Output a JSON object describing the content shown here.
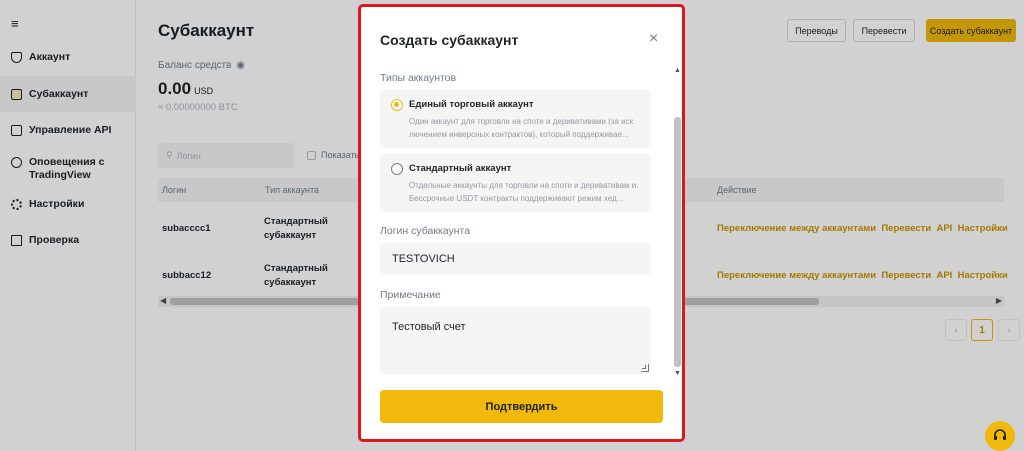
{
  "sidebar": {
    "menu_icon": "menu-icon",
    "items": [
      {
        "label": "Аккаунт",
        "icon": "shield-icon"
      },
      {
        "label": "Субаккаунт",
        "icon": "subaccount-icon"
      },
      {
        "label": "Управление API",
        "icon": "api-icon"
      },
      {
        "label": "Оповещения с TradingView",
        "icon": "bell-icon"
      },
      {
        "label": "Настройки",
        "icon": "gear-icon"
      },
      {
        "label": "Проверка",
        "icon": "clipboard-icon"
      }
    ]
  },
  "page": {
    "title": "Субаккаунт",
    "buttons": {
      "transfers": "Переводы",
      "transfer": "Перевести",
      "create": "Создать субаккаунт"
    },
    "balance_label": "Баланс средств",
    "balance_value": "0.00",
    "balance_currency": "USD",
    "balance_btc": "≈ 0.00000000 BTC",
    "search_placeholder": "Логин",
    "show_label": "Показать",
    "table": {
      "headers": {
        "login": "Логин",
        "type": "Тип аккаунта",
        "action": "Действие"
      },
      "rows": [
        {
          "login": "subacccc1",
          "type": "Стандартный субаккаунт",
          "actions": [
            "Переключение между аккаунтами",
            "Перевести",
            "API",
            "Настройки"
          ]
        },
        {
          "login": "subbacc12",
          "type": "Стандартный субаккаунт",
          "actions": [
            "Переключение между аккаунтами",
            "Перевести",
            "API",
            "Настройки"
          ]
        }
      ]
    },
    "pagination": {
      "prev": "‹",
      "current": "1",
      "next": "›"
    }
  },
  "modal": {
    "title": "Создать субаккаунт",
    "close": "×",
    "account_types_label": "Типы аккаунтов",
    "options": [
      {
        "name": "Единый торговый аккаунт",
        "desc": "Один аккаунт для торговли на споте и деривативами (за иск лючением инверсных контрактов), который поддерживае...",
        "selected": true
      },
      {
        "name": "Стандартный аккаунт",
        "desc": "Отдельные аккаунты для торговли на споте и деривативам и. Бессрочные USDT контракты поддерживают режим хед...",
        "selected": false
      }
    ],
    "login_label": "Логин субаккаунта",
    "login_value": "TESTOVICH",
    "note_label": "Примечание",
    "note_value": "Тестовый счет",
    "confirm": "Подтвердить"
  },
  "colors": {
    "accent": "#f0b90b",
    "highlight_border": "#e0141e",
    "link": "#c99400"
  }
}
